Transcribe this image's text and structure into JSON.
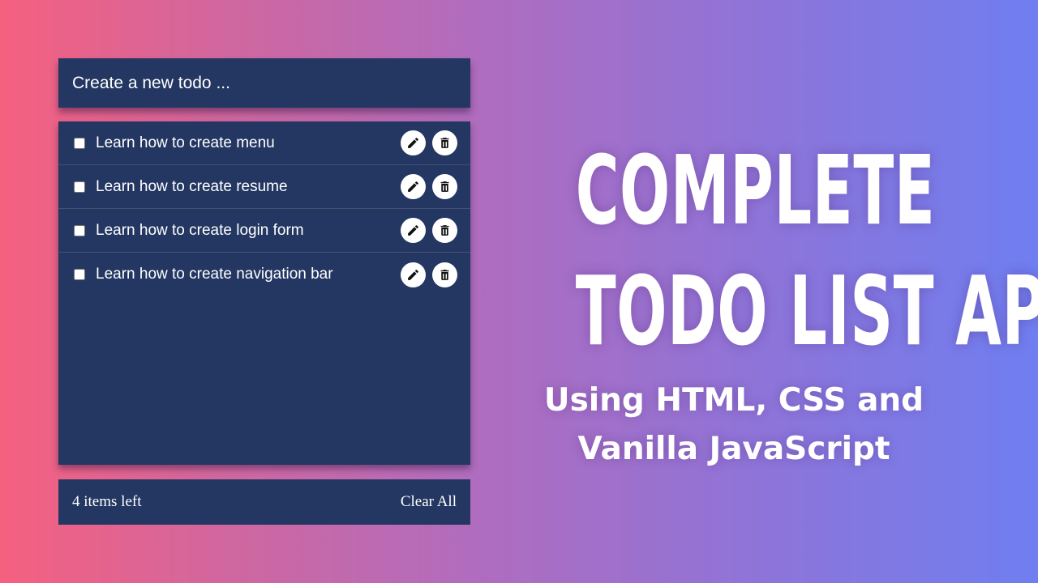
{
  "todo_app": {
    "input": {
      "placeholder": "Create a new todo ...",
      "value": ""
    },
    "items": [
      {
        "text": "Learn how to create menu",
        "checked": false
      },
      {
        "text": "Learn how to create resume",
        "checked": false
      },
      {
        "text": "Learn how to create login form",
        "checked": false
      },
      {
        "text": "Learn how to create navigation bar",
        "checked": false
      }
    ],
    "footer": {
      "items_left": "4 items left",
      "clear_label": "Clear All"
    }
  },
  "banner": {
    "title_line1": "COMPLETE",
    "title_line2": "TODO LIST APP",
    "subtitle_line1": "Using HTML, CSS and",
    "subtitle_line2": "Vanilla JavaScript"
  },
  "icons": {
    "edit": "pencil-icon",
    "delete": "trash-icon"
  },
  "colors": {
    "panel": "#233762",
    "gradient_left": "#f5607f",
    "gradient_right": "#6f7ef0",
    "text": "#ffffff"
  }
}
